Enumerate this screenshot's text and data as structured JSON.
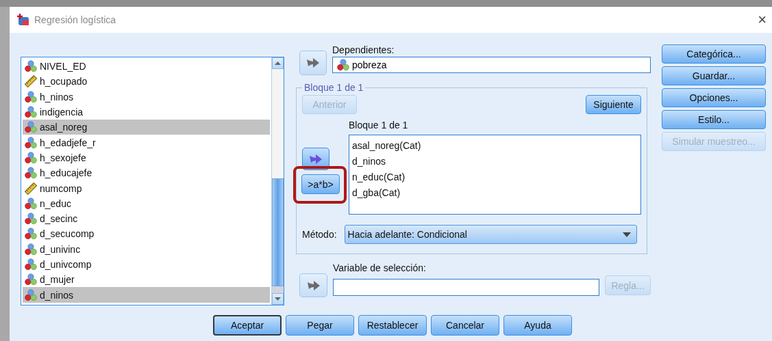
{
  "window": {
    "title": "Regresión logística",
    "close": "×"
  },
  "variables": [
    {
      "name": "NIVEL_ED",
      "kind": "nominal",
      "selected": false
    },
    {
      "name": "h_ocupado",
      "kind": "scale",
      "selected": false
    },
    {
      "name": "h_ninos",
      "kind": "nominal",
      "selected": false
    },
    {
      "name": "indigencia",
      "kind": "nominal",
      "selected": false
    },
    {
      "name": "asal_noreg",
      "kind": "nominal",
      "selected": true
    },
    {
      "name": "h_edadjefe_r",
      "kind": "nominal",
      "selected": false
    },
    {
      "name": "h_sexojefe",
      "kind": "nominal",
      "selected": false
    },
    {
      "name": "h_educajefe",
      "kind": "nominal",
      "selected": false
    },
    {
      "name": "numcomp",
      "kind": "scale",
      "selected": false
    },
    {
      "name": "n_educ",
      "kind": "nominal",
      "selected": false
    },
    {
      "name": "d_secinc",
      "kind": "nominal",
      "selected": false
    },
    {
      "name": "d_secucomp",
      "kind": "nominal",
      "selected": false
    },
    {
      "name": "d_univinc",
      "kind": "nominal",
      "selected": false
    },
    {
      "name": "d_univcomp",
      "kind": "nominal",
      "selected": false
    },
    {
      "name": "d_mujer",
      "kind": "nominal",
      "selected": false
    },
    {
      "name": "d_ninos",
      "kind": "nominal",
      "selected": true
    }
  ],
  "dependent": {
    "label": "Dependientes:",
    "variable": {
      "name": "pobreza",
      "kind": "nominal"
    }
  },
  "block": {
    "title": "Bloque 1 de 1",
    "previous": {
      "label": "Anterior",
      "disabled": true
    },
    "next": {
      "label": "Siguiente",
      "disabled": false
    },
    "list_label": "Bloque 1 de 1",
    "covariates": [
      "asal_noreg(Cat)",
      "d_ninos",
      "n_educ(Cat)",
      "d_gba(Cat)"
    ],
    "interaction": {
      "label": ">a*b>",
      "highlighted": true
    },
    "method_label": "Método:",
    "method": "Hacia adelante: Condicional"
  },
  "selection": {
    "label": "Variable de selección:",
    "rule": {
      "label": "Regla...",
      "disabled": true
    }
  },
  "side_buttons": [
    {
      "label": "Categórica...",
      "disabled": false
    },
    {
      "label": "Guardar...",
      "disabled": false
    },
    {
      "label": "Opciones...",
      "disabled": false
    },
    {
      "label": "Estilo...",
      "disabled": false
    },
    {
      "label": "Simular muestreo...",
      "disabled": true
    }
  ],
  "bottom_buttons": [
    {
      "label": "Aceptar",
      "default": true
    },
    {
      "label": "Pegar",
      "default": false
    },
    {
      "label": "Restablecer",
      "default": false
    },
    {
      "label": "Cancelar",
      "default": false
    },
    {
      "label": "Ayuda",
      "default": false
    }
  ]
}
